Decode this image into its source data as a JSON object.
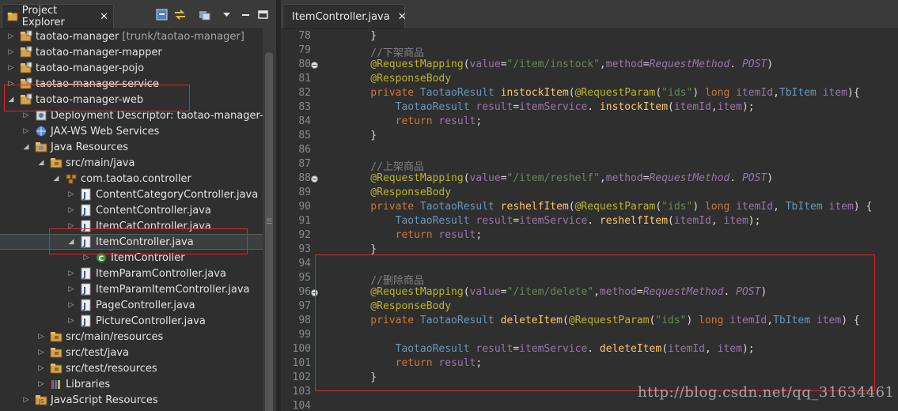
{
  "explorer": {
    "title": "Project Explorer",
    "close_glyph": "✕",
    "tree": [
      {
        "depth": 0,
        "twisty": "▷",
        "icon": "project-icon",
        "label": "taotao-manager",
        "suffix": "[trunk/taotao-manager]"
      },
      {
        "depth": 0,
        "twisty": "▷",
        "icon": "project-icon",
        "label": "taotao-manager-mapper"
      },
      {
        "depth": 0,
        "twisty": "▷",
        "icon": "project-icon",
        "label": "taotao-manager-pojo"
      },
      {
        "depth": 0,
        "twisty": "▷",
        "icon": "project-icon",
        "label": "taotao-manager-service",
        "strike": true
      },
      {
        "depth": 0,
        "twisty": "◢",
        "icon": "project-icon",
        "label": "taotao-manager-web"
      },
      {
        "depth": 1,
        "twisty": "▷",
        "icon": "deployment-descriptor-icon",
        "label": "Deployment Descriptor: taotao-manager-web"
      },
      {
        "depth": 1,
        "twisty": "▷",
        "icon": "web-services-icon",
        "label": "JAX-WS Web Services"
      },
      {
        "depth": 1,
        "twisty": "◢",
        "icon": "java-resources-icon",
        "label": "Java Resources"
      },
      {
        "depth": 2,
        "twisty": "◢",
        "icon": "source-folder-icon",
        "label": "src/main/java"
      },
      {
        "depth": 3,
        "twisty": "◢",
        "icon": "package-icon",
        "label": "com.taotao.controller"
      },
      {
        "depth": 4,
        "twisty": "▷",
        "icon": "java-file-icon",
        "label": "ContentCategoryController.java"
      },
      {
        "depth": 4,
        "twisty": "▷",
        "icon": "java-file-icon",
        "label": "ContentController.java"
      },
      {
        "depth": 4,
        "twisty": "▷",
        "icon": "java-file-icon",
        "label": "ItemCatController.java"
      },
      {
        "depth": 4,
        "twisty": "◢",
        "icon": "java-file-icon",
        "label": "ItemController.java",
        "selected": true
      },
      {
        "depth": 5,
        "twisty": "▷",
        "icon": "class-icon",
        "label": "ItemController"
      },
      {
        "depth": 4,
        "twisty": "▷",
        "icon": "java-file-icon",
        "label": "ItemParamController.java"
      },
      {
        "depth": 4,
        "twisty": "▷",
        "icon": "java-file-icon",
        "label": "ItemParamItemController.java"
      },
      {
        "depth": 4,
        "twisty": "▷",
        "icon": "java-file-icon",
        "label": "PageController.java"
      },
      {
        "depth": 4,
        "twisty": "▷",
        "icon": "java-file-icon",
        "label": "PictureController.java"
      },
      {
        "depth": 2,
        "twisty": "▷",
        "icon": "source-folder-icon",
        "label": "src/main/resources"
      },
      {
        "depth": 2,
        "twisty": "▷",
        "icon": "source-folder-icon",
        "label": "src/test/java"
      },
      {
        "depth": 2,
        "twisty": "▷",
        "icon": "source-folder-icon",
        "label": "src/test/resources"
      },
      {
        "depth": 2,
        "twisty": "▷",
        "icon": "library-icon",
        "label": "Libraries"
      },
      {
        "depth": 1,
        "twisty": "▷",
        "icon": "javascript-resources-icon",
        "label": "JavaScript Resources"
      }
    ]
  },
  "editor": {
    "tab_title": "ItemController.java",
    "close_glyph": "✕",
    "lines": [
      {
        "n": "78",
        "tokens": [
          [
            "",
            "    }"
          ]
        ]
      },
      {
        "n": "79",
        "tokens": [
          [
            "c",
            "    //下架商品"
          ]
        ]
      },
      {
        "n": "80",
        "fold": true,
        "tokens": [
          [
            "a",
            "    @RequestMapping"
          ],
          [
            "",
            "("
          ],
          [
            "pv",
            "value"
          ],
          [
            "",
            "="
          ],
          [
            "s",
            "\"/item/instock\""
          ],
          [
            "",
            ","
          ],
          [
            "pv",
            "method"
          ],
          [
            "",
            "="
          ],
          [
            "cst",
            "RequestMethod"
          ],
          [
            "",
            ". "
          ],
          [
            "cst",
            "POST"
          ],
          [
            "",
            ")"
          ]
        ]
      },
      {
        "n": "81",
        "tokens": [
          [
            "a",
            "    @ResponseBody"
          ]
        ]
      },
      {
        "n": "82",
        "tokens": [
          [
            "k",
            "    private "
          ],
          [
            "t",
            "TaotaoResult "
          ],
          [
            "m",
            "instockItem"
          ],
          [
            "",
            "("
          ],
          [
            "a",
            "@RequestParam"
          ],
          [
            "",
            "("
          ],
          [
            "s",
            "\"ids\""
          ],
          [
            "",
            ") "
          ],
          [
            "k",
            "long "
          ],
          [
            "pv",
            "itemId"
          ],
          [
            "",
            ","
          ],
          [
            "t",
            "TbItem "
          ],
          [
            "pv",
            "item"
          ],
          [
            "",
            "){"
          ]
        ]
      },
      {
        "n": "83",
        "tokens": [
          [
            "t",
            "        TaotaoResult "
          ],
          [
            "pv",
            "result"
          ],
          [
            "",
            "="
          ],
          [
            "pv",
            "itemService"
          ],
          [
            "",
            ". "
          ],
          [
            "m",
            "instockItem"
          ],
          [
            "",
            "("
          ],
          [
            "pv",
            "itemId"
          ],
          [
            "",
            ","
          ],
          [
            "pv",
            "item"
          ],
          [
            "",
            ");"
          ]
        ]
      },
      {
        "n": "84",
        "tokens": [
          [
            "k",
            "        return "
          ],
          [
            "pv",
            "result"
          ],
          [
            "",
            ";"
          ]
        ]
      },
      {
        "n": "85",
        "tokens": [
          [
            "",
            "    }"
          ]
        ]
      },
      {
        "n": "86",
        "tokens": [
          [
            "",
            ""
          ]
        ]
      },
      {
        "n": "87",
        "tokens": [
          [
            "c",
            "    //上架商品"
          ]
        ]
      },
      {
        "n": "88",
        "fold": true,
        "tokens": [
          [
            "a",
            "    @RequestMapping"
          ],
          [
            "",
            "("
          ],
          [
            "pv",
            "value"
          ],
          [
            "",
            "="
          ],
          [
            "s",
            "\"/item/reshelf\""
          ],
          [
            "",
            ","
          ],
          [
            "pv",
            "method"
          ],
          [
            "",
            "="
          ],
          [
            "cst",
            "RequestMethod"
          ],
          [
            "",
            ". "
          ],
          [
            "cst",
            "POST"
          ],
          [
            "",
            ")"
          ]
        ]
      },
      {
        "n": "89",
        "tokens": [
          [
            "a",
            "    @ResponseBody"
          ]
        ]
      },
      {
        "n": "90",
        "tokens": [
          [
            "k",
            "    private "
          ],
          [
            "t",
            "TaotaoResult "
          ],
          [
            "m",
            "reshelfItem"
          ],
          [
            "",
            "("
          ],
          [
            "a",
            "@RequestParam"
          ],
          [
            "",
            "("
          ],
          [
            "s",
            "\"ids\""
          ],
          [
            "",
            ") "
          ],
          [
            "k",
            "long "
          ],
          [
            "pv",
            "itemId"
          ],
          [
            "",
            ", "
          ],
          [
            "t",
            "TbItem "
          ],
          [
            "pv",
            "item"
          ],
          [
            "",
            ") {"
          ]
        ]
      },
      {
        "n": "91",
        "tokens": [
          [
            "t",
            "        TaotaoResult "
          ],
          [
            "pv",
            "result"
          ],
          [
            "",
            "="
          ],
          [
            "pv",
            "itemService"
          ],
          [
            "",
            ". "
          ],
          [
            "m",
            "reshelfItem"
          ],
          [
            "",
            "("
          ],
          [
            "pv",
            "itemId"
          ],
          [
            "",
            ", "
          ],
          [
            "pv",
            "item"
          ],
          [
            "",
            ");"
          ]
        ]
      },
      {
        "n": "92",
        "tokens": [
          [
            "k",
            "        return "
          ],
          [
            "pv",
            "result"
          ],
          [
            "",
            ";"
          ]
        ]
      },
      {
        "n": "93",
        "tokens": [
          [
            "",
            "    }"
          ]
        ]
      },
      {
        "n": "94",
        "tokens": [
          [
            "",
            ""
          ]
        ]
      },
      {
        "n": "95",
        "tokens": [
          [
            "c",
            "    //删除商品"
          ]
        ]
      },
      {
        "n": "96",
        "fold": true,
        "tokens": [
          [
            "a",
            "    @RequestMapping"
          ],
          [
            "",
            "("
          ],
          [
            "pv",
            "value"
          ],
          [
            "",
            "="
          ],
          [
            "s",
            "\"/item/delete\""
          ],
          [
            "",
            ","
          ],
          [
            "pv",
            "method"
          ],
          [
            "",
            "="
          ],
          [
            "cst",
            "RequestMethod"
          ],
          [
            "",
            ". "
          ],
          [
            "cst",
            "POST"
          ],
          [
            "",
            ")"
          ]
        ]
      },
      {
        "n": "97",
        "tokens": [
          [
            "a",
            "    @ResponseBody"
          ]
        ]
      },
      {
        "n": "98",
        "tokens": [
          [
            "k",
            "    private "
          ],
          [
            "t",
            "TaotaoResult "
          ],
          [
            "m",
            "deleteItem"
          ],
          [
            "",
            "("
          ],
          [
            "a",
            "@RequestParam"
          ],
          [
            "",
            "("
          ],
          [
            "s",
            "\"ids\""
          ],
          [
            "",
            ") "
          ],
          [
            "k",
            "long "
          ],
          [
            "pv",
            "itemId"
          ],
          [
            "",
            ","
          ],
          [
            "t",
            "TbItem "
          ],
          [
            "pv",
            "item"
          ],
          [
            "",
            ") {"
          ]
        ]
      },
      {
        "n": "99",
        "tokens": [
          [
            "",
            ""
          ]
        ]
      },
      {
        "n": "100",
        "tokens": [
          [
            "t",
            "        TaotaoResult "
          ],
          [
            "pv",
            "result"
          ],
          [
            "",
            "="
          ],
          [
            "pv",
            "itemService"
          ],
          [
            "",
            ". "
          ],
          [
            "m",
            "deleteItem"
          ],
          [
            "",
            "("
          ],
          [
            "pv",
            "itemId"
          ],
          [
            "",
            ", "
          ],
          [
            "pv",
            "item"
          ],
          [
            "",
            ");"
          ]
        ]
      },
      {
        "n": "101",
        "tokens": [
          [
            "k",
            "        return "
          ],
          [
            "pv",
            "result"
          ],
          [
            "",
            ";"
          ]
        ]
      },
      {
        "n": "102",
        "tokens": [
          [
            "",
            "    }"
          ]
        ]
      },
      {
        "n": "103",
        "tokens": [
          [
            "",
            ""
          ]
        ]
      },
      {
        "n": "104",
        "tokens": [
          [
            "",
            ""
          ]
        ]
      }
    ]
  },
  "watermark": "http://blog.csdn.net/qq_31634461",
  "colors": {
    "highlight_box": "#d9272e",
    "background": "#2b2b2b"
  }
}
